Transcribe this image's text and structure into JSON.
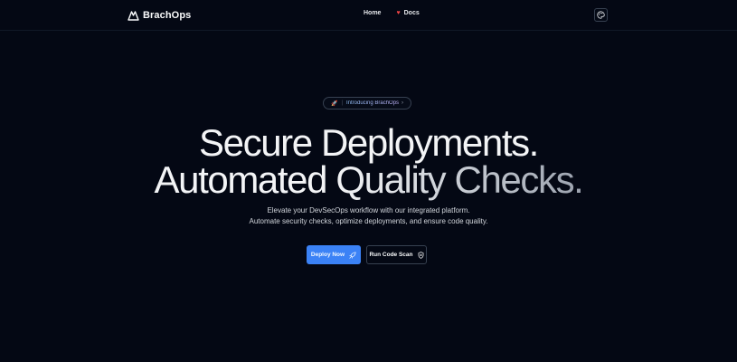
{
  "brand": {
    "name": "BrachOps",
    "logo_icon": "mountain-logo-icon"
  },
  "nav": {
    "items": [
      {
        "label": "Home"
      },
      {
        "label": "Docs",
        "icon": "heart-icon",
        "icon_glyph": "♥"
      }
    ]
  },
  "theme_toggle": {
    "icon": "palette-icon"
  },
  "badge": {
    "icon": "rocket-icon",
    "icon_glyph": "🚀",
    "separator": "|",
    "text": "Introducing BrachOps",
    "chevron": "›"
  },
  "hero": {
    "title_line1": "Secure Deployments.",
    "title_line2_a": "Automated",
    "title_line2_b": "Quality Checks.",
    "subtitle_line1": "Elevate your DevSecOps workflow with our integrated platform.",
    "subtitle_line2": "Automate security checks, optimize deployments, and ensure code quality."
  },
  "actions": {
    "primary": {
      "label": "Deploy Now",
      "icon": "rocket-icon"
    },
    "secondary": {
      "label": "Run Code Scan",
      "icon": "shield-icon"
    }
  },
  "colors": {
    "background": "#040814",
    "primary": "#3b82f6",
    "heart": "#ef4444",
    "border": "#374151"
  }
}
